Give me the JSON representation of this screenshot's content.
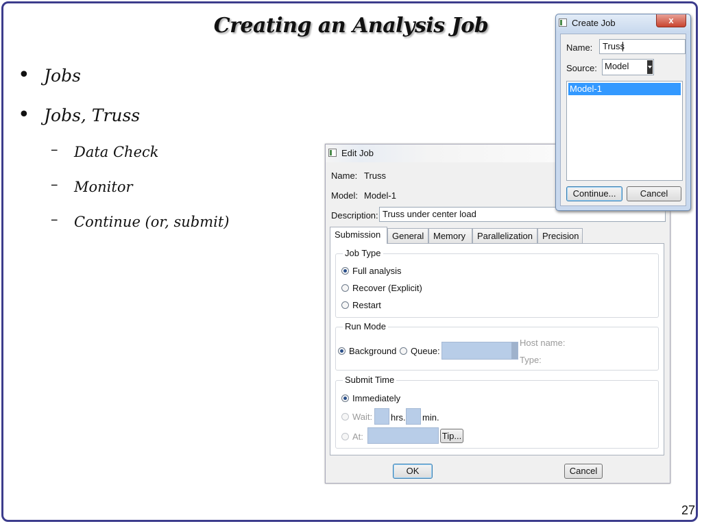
{
  "slide": {
    "title": "Creating an Analysis Job",
    "bullets": [
      "Jobs",
      "Jobs, Truss"
    ],
    "sub_items": [
      "Data Check",
      "Monitor",
      "Continue (or, submit)"
    ],
    "page_number": "27"
  },
  "edit_job": {
    "title": "Edit Job",
    "name_label": "Name:",
    "name_value": "Truss",
    "model_label": "Model:",
    "model_value": "Model-1",
    "description_label": "Description:",
    "description_value": "Truss under center load",
    "tabs": [
      "Submission",
      "General",
      "Memory",
      "Parallelization",
      "Precision"
    ],
    "active_tab": "Submission",
    "job_type": {
      "title": "Job Type",
      "options": [
        "Full analysis",
        "Recover (Explicit)",
        "Restart"
      ],
      "selected": "Full analysis"
    },
    "run_mode": {
      "title": "Run Mode",
      "background_label": "Background",
      "queue_label": "Queue:",
      "host_name_label": "Host name:",
      "type_label": "Type:",
      "selected": "Background"
    },
    "submit_time": {
      "title": "Submit Time",
      "immediately_label": "Immediately",
      "wait_label": "Wait:",
      "hrs_label": "hrs.",
      "min_label": "min.",
      "at_label": "At:",
      "tip_label": "Tip...",
      "selected": "Immediately"
    },
    "ok_label": "OK",
    "cancel_label": "Cancel"
  },
  "create_job": {
    "title": "Create Job",
    "close_label": "x",
    "name_label": "Name:",
    "name_value": "Truss",
    "source_label": "Source:",
    "source_value": "Model",
    "models": [
      "Model-1"
    ],
    "continue_label": "Continue...",
    "cancel_label": "Cancel"
  },
  "colors": {
    "frame_border": "#3c3c8c",
    "selection": "#3399ff",
    "disabled_field": "#b8cde8"
  }
}
